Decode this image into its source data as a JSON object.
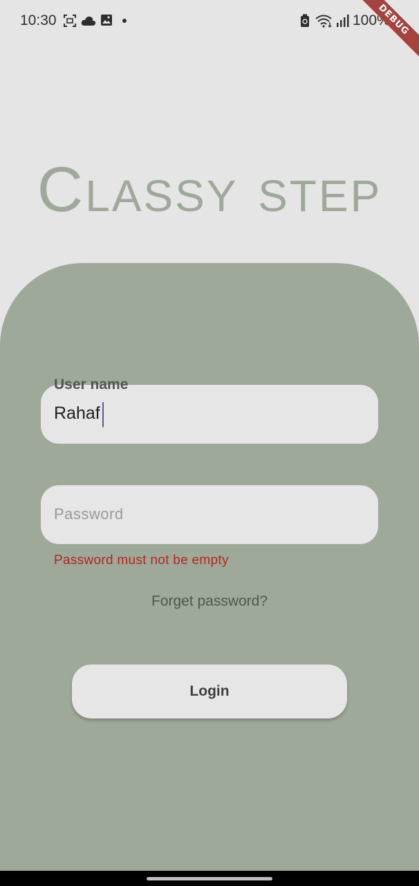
{
  "status_bar": {
    "time": "10:30",
    "battery": "100%",
    "icons_left": [
      "screenshot-icon",
      "cloud-icon",
      "gallery-icon",
      "dot-icon"
    ],
    "icons_right": [
      "battery-saver-icon",
      "wifi-icon",
      "signal-icon"
    ]
  },
  "debug_banner": "DEBUG",
  "logo": {
    "text": "Classy step",
    "color": "#9ea999"
  },
  "form": {
    "username_label": "User name",
    "username_value": "Rahaf",
    "password_placeholder": "Password",
    "password_error": "Password must not be empty",
    "forget_password": "Forget password?",
    "login_button": "Login"
  },
  "colors": {
    "background": "#e5e5e5",
    "panel": "#9ea999",
    "field": "#e6e6e6",
    "error": "#b3261e",
    "cursor": "#6650a4"
  }
}
